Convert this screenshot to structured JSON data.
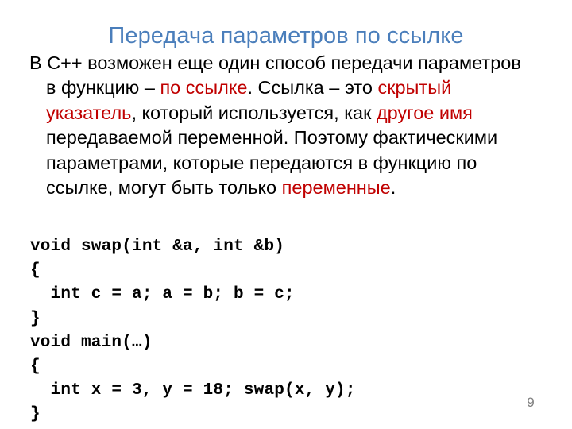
{
  "slide": {
    "title": "Передача параметров по ссылке",
    "page_number": "9",
    "colors": {
      "title": "#4A7EBB",
      "highlight": "#C00000",
      "body": "#000000",
      "page_number": "#808080",
      "background": "#FFFFFF"
    }
  },
  "body": {
    "runs": {
      "r1": "В С++ возможен еще один способ передачи параметров в функцию – ",
      "r2_red": "по ссылке",
      "r3": ". Ссылка – это ",
      "r4_red": "скрытый указатель",
      "r5": ", который используется, как ",
      "r6_red": "другое имя",
      "r7": " передаваемой переменной. Поэтому фактическими параметрами, которые передаются в функцию по ссылке, могут быть только ",
      "r8_red": "переменные",
      "r9": "."
    },
    "plain_text": "В С++ возможен еще один способ передачи параметров в функцию – по ссылке. Ссылка – это скрытый указатель, который используется, как другое имя передаваемой переменной. Поэтому фактическими параметрами, которые передаются в функцию по ссылке, могут быть только переменные."
  },
  "code": {
    "language": "C++",
    "lines": [
      "void swap(int &a, int &b)",
      "{",
      "  int c = a; a = b; b = c;",
      "}",
      "void main(…)",
      "{",
      "  int x = 3, y = 18; swap(x, y);",
      "}"
    ],
    "text": "void swap(int &a, int &b)\n{\n  int c = a; a = b; b = c;\n}\nvoid main(…)\n{\n  int x = 3, y = 18; swap(x, y);\n}"
  }
}
